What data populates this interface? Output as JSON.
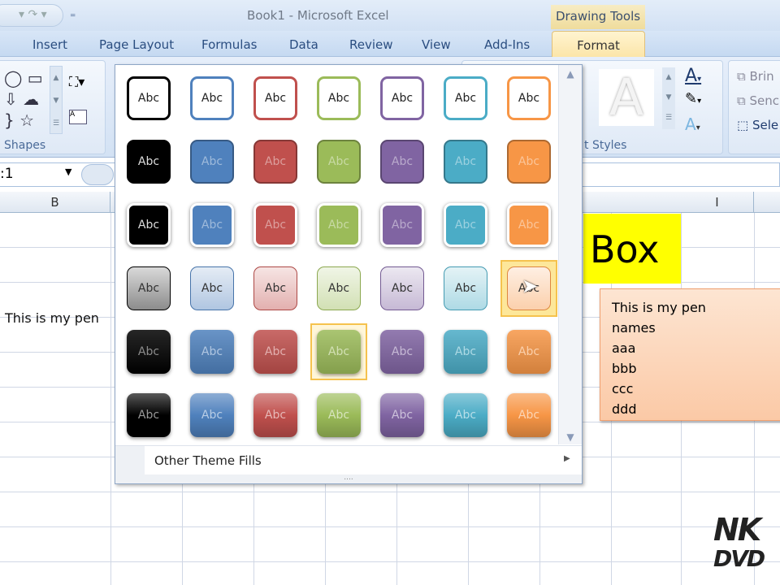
{
  "window": {
    "title": "Book1 - Microsoft Excel",
    "context_tab_group": "Drawing Tools"
  },
  "tabs": [
    "Insert",
    "Page Layout",
    "Formulas",
    "Data",
    "Review",
    "View",
    "Add-Ins",
    "Format"
  ],
  "ribbon": {
    "shapes_label": "Shapes",
    "styles_label": "t Styles",
    "arrange": [
      "Brin",
      "Senc",
      "Sele"
    ],
    "wordart_letter": "A"
  },
  "name_box": ":1",
  "columns": {
    "b": "B",
    "i": "I"
  },
  "cells": {
    "b_text": "This is my pen"
  },
  "shapes": {
    "yellow_box": "Box",
    "orange_box": [
      "This  is my pen",
      "names",
      "aaa",
      "bbb",
      "ccc",
      "ddd"
    ]
  },
  "gallery": {
    "label": "Abc",
    "colors": [
      "#000000",
      "#4f81bd",
      "#c0504d",
      "#9bbb59",
      "#8064a2",
      "#4bacc6",
      "#f79646"
    ],
    "rows": 6,
    "hovered": {
      "row": 4,
      "col": 7
    },
    "selected": {
      "row": 5,
      "col": 4
    },
    "other_fills": "Other Theme Fills"
  },
  "watermark": "NK DVD"
}
